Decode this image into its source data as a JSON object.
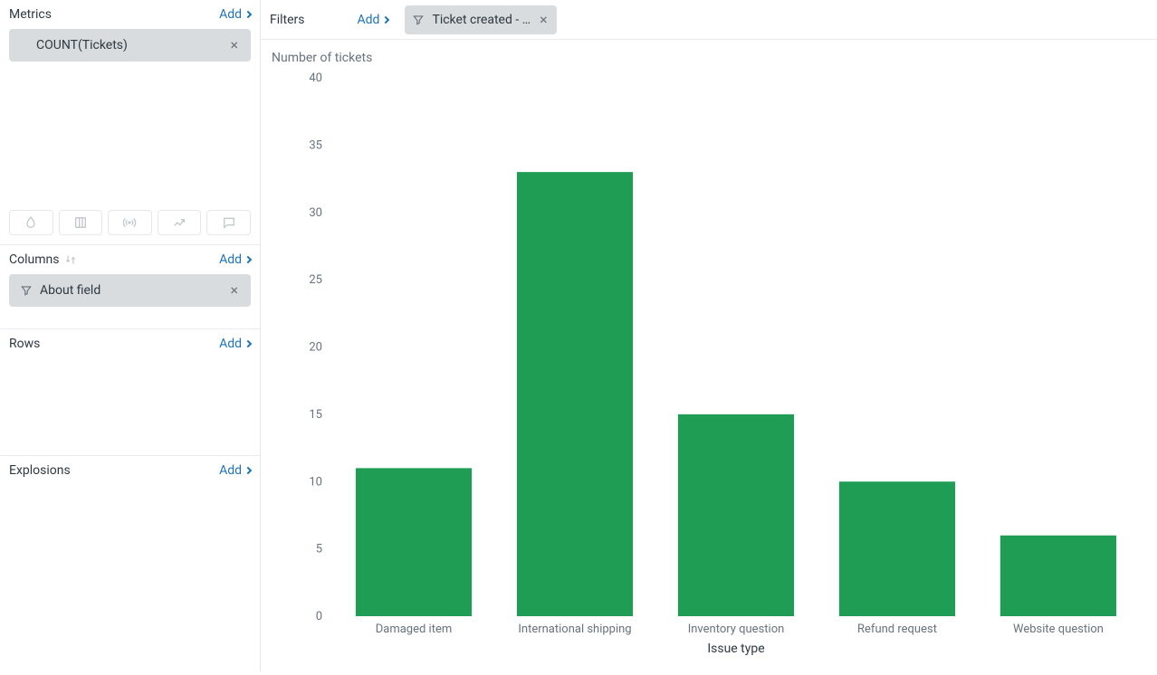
{
  "sidebar": {
    "metrics": {
      "title": "Metrics",
      "add_label": "Add",
      "items": [
        {
          "label": "COUNT(Tickets)"
        }
      ]
    },
    "columns": {
      "title": "Columns",
      "add_label": "Add",
      "items": [
        {
          "label": "About field"
        }
      ]
    },
    "rows": {
      "title": "Rows",
      "add_label": "Add"
    },
    "explosions": {
      "title": "Explosions",
      "add_label": "Add"
    }
  },
  "filters": {
    "title": "Filters",
    "add_label": "Add",
    "items": [
      {
        "label": "Ticket created - …"
      }
    ]
  },
  "chart": {
    "y_title": "Number of tickets",
    "x_title": "Issue type"
  },
  "chart_data": {
    "type": "bar",
    "categories": [
      "Damaged item",
      "International shipping",
      "Inventory question",
      "Refund request",
      "Website question"
    ],
    "values": [
      11,
      33,
      15,
      10,
      6
    ],
    "title": "Number of tickets",
    "xlabel": "Issue type",
    "ylabel": "",
    "ylim": [
      0,
      40
    ],
    "ytick_step": 5,
    "bar_color": "#1f9d55"
  }
}
